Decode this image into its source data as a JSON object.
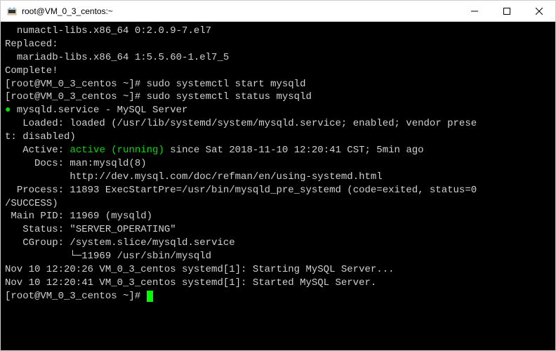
{
  "window": {
    "title": "root@VM_0_3_centos:~"
  },
  "term": {
    "l1": "  numactl-libs.x86_64 0:2.0.9-7.el7",
    "l2": "",
    "l3": "Replaced:",
    "l4": "  mariadb-libs.x86_64 1:5.5.60-1.el7_5",
    "l5": "",
    "l6": "Complete!",
    "p1": "[root@VM_0_3_centos ~]# ",
    "c1": "sudo systemctl start mysqld",
    "p2": "[root@VM_0_3_centos ~]# ",
    "c2": "sudo systemctl status mysqld",
    "s_bullet": "●",
    "s_name": " mysqld.service - MySQL Server",
    "s_loaded": "   Loaded: loaded (/usr/lib/systemd/system/mysqld.service; enabled; vendor prese",
    "s_loaded2": "t: disabled)",
    "s_active_lbl": "   Active: ",
    "s_active_val": "active (running)",
    "s_active_rest": " since Sat 2018-11-10 12:20:41 CST; 5min ago",
    "s_docs1": "     Docs: man:mysqld(8)",
    "s_docs2": "           http://dev.mysql.com/doc/refman/en/using-systemd.html",
    "s_proc1": "  Process: 11893 ExecStartPre=/usr/bin/mysqld_pre_systemd (code=exited, status=0",
    "s_proc2": "/SUCCESS)",
    "s_pid": " Main PID: 11969 (mysqld)",
    "s_status": "   Status: \"SERVER_OPERATING\"",
    "s_cgroup1": "   CGroup: /system.slice/mysqld.service",
    "s_cgroup2": "           └─11969 /usr/sbin/mysqld",
    "s_blank": "",
    "log1": "Nov 10 12:20:26 VM_0_3_centos systemd[1]: Starting MySQL Server...",
    "log2": "Nov 10 12:20:41 VM_0_3_centos systemd[1]: Started MySQL Server.",
    "p3": "[root@VM_0_3_centos ~]# "
  }
}
